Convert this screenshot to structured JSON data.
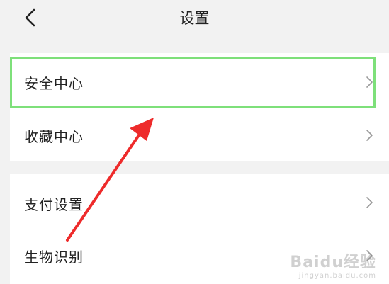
{
  "header": {
    "title": "设置",
    "back_icon": "chevron-left-icon"
  },
  "settings_groups": [
    {
      "items": [
        {
          "label": "安全中心",
          "chevron_icon": "chevron-right-icon",
          "highlighted": true
        },
        {
          "label": "收藏中心",
          "chevron_icon": "chevron-right-icon",
          "highlighted": false
        }
      ]
    },
    {
      "items": [
        {
          "label": "支付设置",
          "chevron_icon": "chevron-right-icon",
          "highlighted": false
        },
        {
          "label": "生物识别",
          "chevron_icon": "chevron-right-icon",
          "highlighted": false
        }
      ]
    }
  ],
  "annotation": {
    "highlight_color": "#7ee07a",
    "arrow_color": "#ee2b2b"
  },
  "watermark": {
    "main": "Baidu经验",
    "sub": "jingyan.baidu.com"
  },
  "colors": {
    "background": "#f2f2f2",
    "card": "#ffffff",
    "text": "#222222",
    "chevron": "#9a9a9a"
  }
}
